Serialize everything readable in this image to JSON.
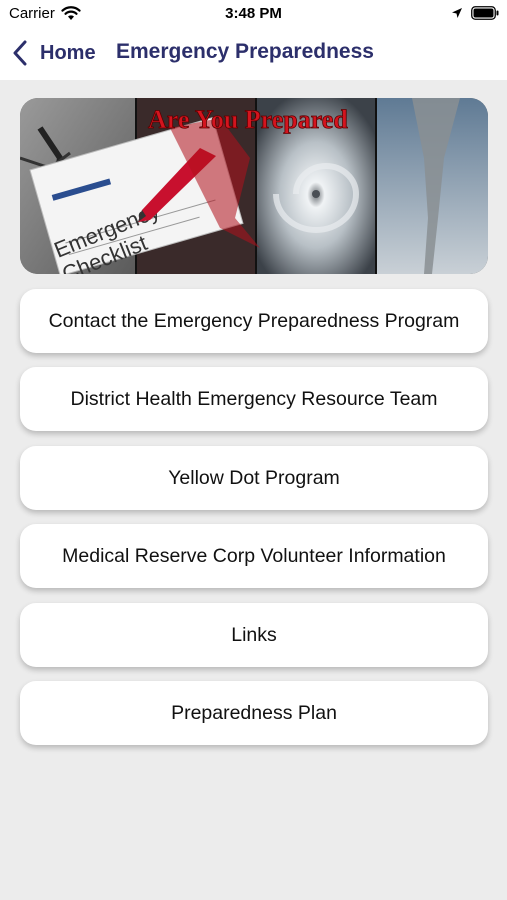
{
  "status_bar": {
    "carrier": "Carrier",
    "time": "3:48 PM"
  },
  "nav": {
    "back_label": "Home",
    "title": "Emergency Preparedness"
  },
  "banner": {
    "headline": "Are You Prepared",
    "checklist_line1": "Emergency",
    "checklist_line2": "Checklist"
  },
  "menu": [
    {
      "label": "Contact the Emergency Preparedness Program"
    },
    {
      "label": "District Health Emergency Resource Team"
    },
    {
      "label": "Yellow Dot Program"
    },
    {
      "label": "Medical Reserve Corp Volunteer Information"
    },
    {
      "label": "Links"
    },
    {
      "label": "Preparedness Plan"
    }
  ],
  "colors": {
    "nav_text": "#2c2f6b",
    "background": "#ececec",
    "headline": "#d4141e"
  }
}
